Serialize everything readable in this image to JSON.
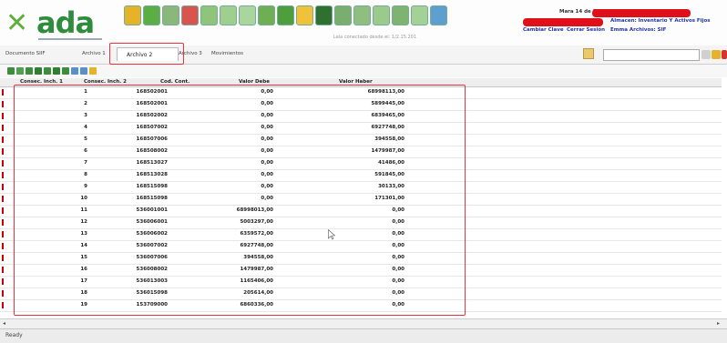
{
  "header": {
    "logo_text": "ada",
    "version_text": "Leia conectado desde el: 1/2.15.201",
    "user": {
      "date_label": "Mara 14 de 2013",
      "session_info": "Almacen: Inventario Y Activos Fijos",
      "company_info": "Emma Archivos: SIF",
      "links": [
        "Cambiar Clave",
        "Cerrar Sesión"
      ]
    }
  },
  "tabs": [
    {
      "label": "Documento SIIF"
    },
    {
      "label": "Archivo 1"
    },
    {
      "label": "Archivo 2"
    },
    {
      "label": "Archivo 3"
    },
    {
      "label": "Movimientos"
    }
  ],
  "grid": {
    "columns": [
      "Consec. Inch. 1",
      "Consec. Inch. 2",
      "Cod. Cont.",
      "Valor Debe",
      "Valor Haber"
    ],
    "rows": [
      [
        "1",
        "1",
        "168502001",
        "0,00",
        "68998113,00"
      ],
      [
        "1",
        "2",
        "168502001",
        "0,00",
        "5899445,00"
      ],
      [
        "1",
        "3",
        "168502002",
        "0,00",
        "6839465,00"
      ],
      [
        "1",
        "4",
        "168507002",
        "0,00",
        "6927748,00"
      ],
      [
        "1",
        "5",
        "168507006",
        "0,00",
        "394558,00"
      ],
      [
        "1",
        "6",
        "168508002",
        "0,00",
        "1479987,00"
      ],
      [
        "1",
        "7",
        "168513027",
        "0,00",
        "41486,00"
      ],
      [
        "1",
        "8",
        "168513028",
        "0,00",
        "591845,00"
      ],
      [
        "1",
        "9",
        "168515098",
        "0,00",
        "30133,00"
      ],
      [
        "1",
        "10",
        "168515098",
        "0,00",
        "171301,00"
      ],
      [
        "1",
        "11",
        "536001001",
        "68998013,00",
        "0,00"
      ],
      [
        "1",
        "12",
        "536006001",
        "5003297,00",
        "0,00"
      ],
      [
        "1",
        "13",
        "536006002",
        "6359572,00",
        "0,00"
      ],
      [
        "1",
        "14",
        "536007002",
        "6927748,00",
        "0,00"
      ],
      [
        "1",
        "15",
        "536007006",
        "394558,00",
        "0,00"
      ],
      [
        "1",
        "16",
        "536008002",
        "1479987,00",
        "0,00"
      ],
      [
        "1",
        "17",
        "536013003",
        "1165406,00",
        "0,00"
      ],
      [
        "1",
        "18",
        "536015098",
        "205614,00",
        "0,00"
      ],
      [
        "2",
        "19",
        "153709000",
        "6860336,00",
        "0,00"
      ]
    ]
  },
  "status": {
    "text": "Ready"
  },
  "colors": {
    "logo_green": "#2e8c3c",
    "highlight": "#e8323c",
    "redaction": "#e0101a",
    "link_blue": "#2233aa"
  }
}
